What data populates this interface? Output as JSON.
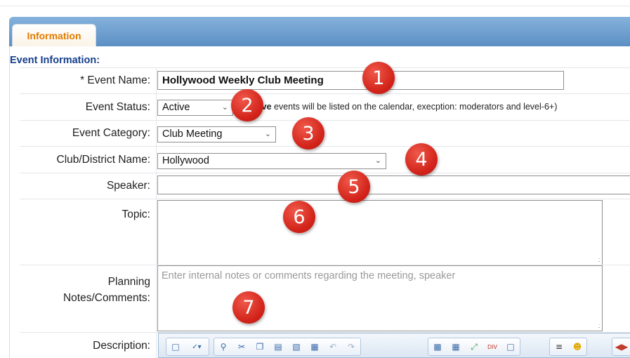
{
  "tabs": [
    {
      "label": "Information"
    }
  ],
  "section_title": "Event Information:",
  "fields": {
    "event_name": {
      "label": "* Event Name:",
      "value": "Hollywood Weekly Club Meeting"
    },
    "event_status": {
      "label": "Event Status:",
      "value": "Active",
      "note_bold": "Active",
      "note_rest": " events will be listed on the calendar, execption: moderators and level-6+)"
    },
    "event_category": {
      "label": "Event Category:",
      "value": "Club Meeting"
    },
    "club_name": {
      "label": "Club/District Name:",
      "value": "Hollywood"
    },
    "speaker": {
      "label": "Speaker:",
      "value": ""
    },
    "topic": {
      "label": "Topic:",
      "value": ""
    },
    "planning_notes": {
      "label_line1": "Planning",
      "label_line2": "Notes/Comments:",
      "placeholder": "Enter internal notes or comments regarding the meeting, speaker"
    },
    "description": {
      "label": "Description:"
    }
  },
  "badges": [
    "1",
    "2",
    "3",
    "4",
    "5",
    "6",
    "7"
  ],
  "toolbar_icons": [
    "new-page-icon",
    "spellcheck-icon",
    "find-icon",
    "cut-icon",
    "copy-icon",
    "paste-icon",
    "paste-text-icon",
    "paste-word-icon",
    "undo-icon",
    "redo-icon",
    "image-icon",
    "table-icon",
    "maximize-icon",
    "div-icon",
    "iframe-icon",
    "align-icon",
    "smiley-icon",
    "source-icon"
  ],
  "colors": {
    "accent_tab_text": "#e07b00",
    "section_title": "#163f8c",
    "tab_bar": "#6a9fd0",
    "badge": "#d2231a"
  }
}
